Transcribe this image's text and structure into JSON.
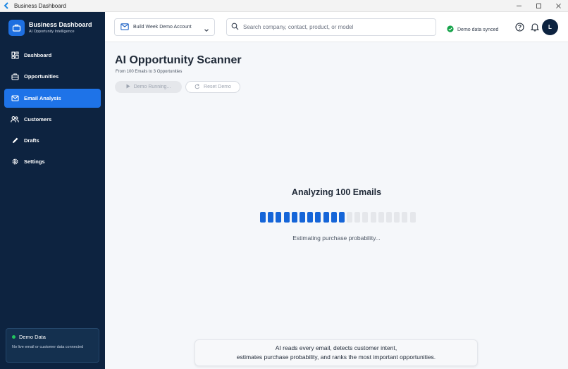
{
  "window": {
    "title": "Business Dashboard"
  },
  "sidebar": {
    "brand_name": "Business Dashboard",
    "brand_subtitle": "AI Opportunity Intelligence",
    "items": [
      {
        "label": "Dashboard",
        "icon": "grid-icon",
        "active": false
      },
      {
        "label": "Opportunities",
        "icon": "briefcase-icon",
        "active": false
      },
      {
        "label": "Email Analysis",
        "icon": "mail-icon",
        "active": true
      },
      {
        "label": "Customers",
        "icon": "users-icon",
        "active": false
      },
      {
        "label": "Drafts",
        "icon": "pencil-icon",
        "active": false
      },
      {
        "label": "Settings",
        "icon": "gear-icon",
        "active": false
      }
    ],
    "demo": {
      "title": "Demo Data",
      "text": "No live email or customer data connected"
    }
  },
  "header": {
    "account_label": "Build Week Demo Account",
    "search_placeholder": "Search company, contact, product, or model",
    "sync_status": "Demo data synced",
    "avatar_initial": "L"
  },
  "main": {
    "title": "AI Opportunity Scanner",
    "subtitle": "From 100 Emails to 3 Opportunities",
    "run_button": "Demo Running...",
    "reset_button": "Reset Demo",
    "analyzing_title": "Analyzing 100 Emails",
    "progress": {
      "filled": 11,
      "total": 20
    },
    "status_text": "Estimating purchase probability...",
    "info_line1": "AI reads every email, detects customer intent,",
    "info_line2": "estimates purchase probability, and ranks the most important opportunities."
  },
  "colors": {
    "sidebar_bg": "#0d2340",
    "accent": "#1e73e8",
    "progress": "#1565d8",
    "success": "#22c55e"
  }
}
